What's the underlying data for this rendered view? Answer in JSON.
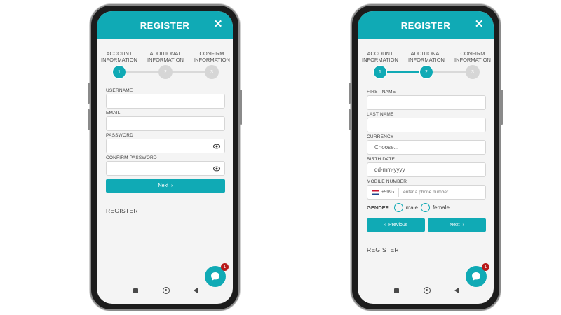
{
  "colors": {
    "accent": "#10aab5",
    "badge": "#b81a1a"
  },
  "left_phone": {
    "header": {
      "title": "REGISTER",
      "close": "✕"
    },
    "steps": [
      {
        "label_l1": "ACCOUNT",
        "label_l2": "INFORMATION",
        "number": "1",
        "state": "active"
      },
      {
        "label_l1": "ADDITIONAL",
        "label_l2": "INFORMATION",
        "number": "2",
        "state": "inactive"
      },
      {
        "label_l1": "CONFIRM",
        "label_l2": "INFORMATION",
        "number": "3",
        "state": "inactive"
      }
    ],
    "fields": {
      "username_label": "USERNAME",
      "email_label": "EMAIL",
      "password_label": "PASSWORD",
      "confirm_password_label": "CONFIRM PASSWORD"
    },
    "next_label": "Next",
    "register_text": "REGISTER",
    "chat_badge": "1"
  },
  "right_phone": {
    "header": {
      "title": "REGISTER",
      "close": "✕"
    },
    "steps": [
      {
        "label_l1": "ACCOUNT",
        "label_l2": "INFORMATION",
        "number": "1",
        "state": "active"
      },
      {
        "label_l1": "ADDITIONAL",
        "label_l2": "INFORMATION",
        "number": "2",
        "state": "active"
      },
      {
        "label_l1": "CONFIRM",
        "label_l2": "INFORMATION",
        "number": "3",
        "state": "inactive"
      }
    ],
    "fields": {
      "first_name_label": "FIRST NAME",
      "last_name_label": "LAST NAME",
      "currency_label": "CURRENCY",
      "currency_value": "Choose...",
      "birth_date_label": "BIRTH DATE",
      "birth_date_placeholder": "dd-mm-yyyy",
      "mobile_label": "MOBILE NUMBER",
      "country_code": "+599",
      "phone_placeholder": "enter a phone number"
    },
    "gender": {
      "label": "GENDER:",
      "male": "male",
      "female": "female"
    },
    "previous_label": "Previous",
    "next_label": "Next",
    "register_text": "REGISTER",
    "chat_badge": "1"
  }
}
